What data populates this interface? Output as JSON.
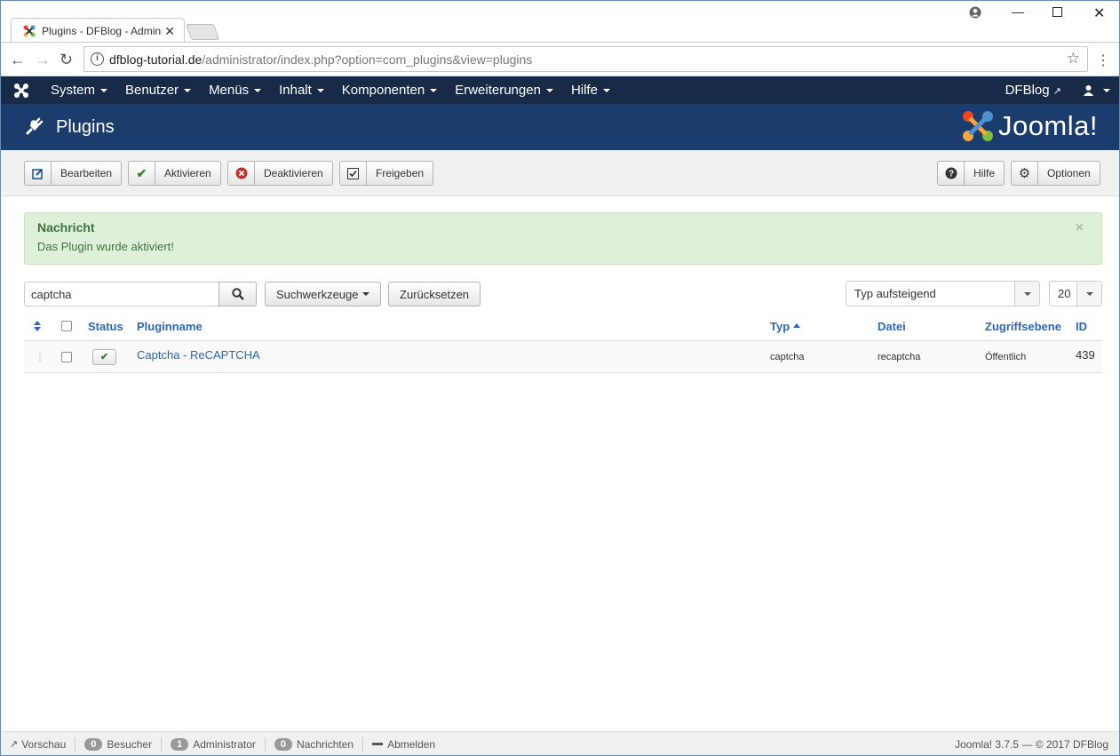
{
  "browser": {
    "tab_title": "Plugins - DFBlog - Administration",
    "url_host": "dfblog-tutorial.de",
    "url_path": "/administrator/index.php?option=com_plugins&view=plugins"
  },
  "navbar": {
    "items": [
      "System",
      "Benutzer",
      "Menüs",
      "Inhalt",
      "Komponenten",
      "Erweiterungen",
      "Hilfe"
    ],
    "site_name": "DFBlog"
  },
  "header": {
    "title": "Plugins",
    "brand": "Joomla!"
  },
  "toolbar": {
    "edit": "Bearbeiten",
    "enable": "Aktivieren",
    "disable": "Deaktivieren",
    "checkin": "Freigeben",
    "help": "Hilfe",
    "options": "Optionen"
  },
  "alert": {
    "heading": "Nachricht",
    "message": "Das Plugin wurde aktiviert!",
    "close": "×"
  },
  "filters": {
    "search_value": "captcha",
    "search_tools": "Suchwerkzeuge",
    "reset": "Zurücksetzen",
    "ordering": "Typ aufsteigend",
    "limit": "20"
  },
  "table": {
    "headers": {
      "status": "Status",
      "name": "Pluginname",
      "type": "Typ",
      "file": "Datei",
      "access": "Zugriffsebene",
      "id": "ID"
    },
    "rows": [
      {
        "name": "Captcha - ReCAPTCHA",
        "type": "captcha",
        "file": "recaptcha",
        "access": "Öffentlich",
        "id": "439",
        "enabled": true
      }
    ]
  },
  "footer": {
    "preview": "Vorschau",
    "visitors_count": "0",
    "visitors": "Besucher",
    "admins_count": "1",
    "admins": "Administrator",
    "messages_count": "0",
    "messages": "Nachrichten",
    "logout": "Abmelden",
    "copyright": "Joomla! 3.7.5 — © 2017 DFBlog"
  },
  "colors": {
    "navbar": "#172a47",
    "header": "#1b3d6e",
    "link": "#2a69b8",
    "alert_bg": "#dff0d8"
  }
}
